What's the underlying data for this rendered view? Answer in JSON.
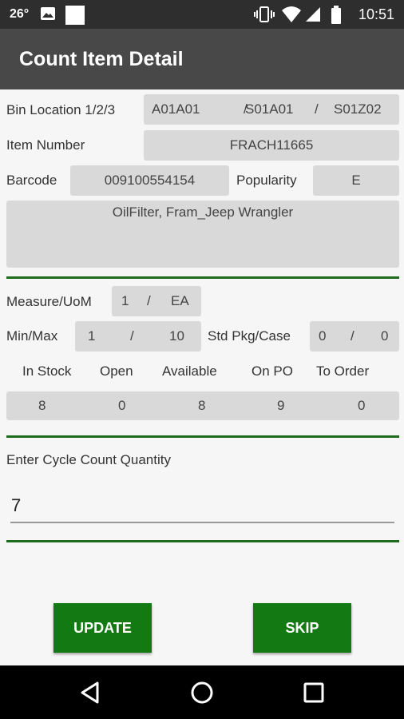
{
  "status_bar": {
    "temperature": "26°",
    "time": "10:51",
    "icons": [
      "image-icon",
      "square-notification-icon",
      "vibrate-icon",
      "wifi-icon",
      "signal-icon",
      "battery-icon"
    ]
  },
  "app_bar": {
    "title": "Count Item Detail"
  },
  "bin": {
    "label": "Bin Location 1/2/3",
    "loc1": "A01A01",
    "sep1": "/",
    "loc2": "S01A01",
    "sep2": "/",
    "loc3": "S01Z02"
  },
  "item": {
    "label": "Item Number",
    "value": "FRACH11665"
  },
  "barcode": {
    "label": "Barcode",
    "value": "009100554154"
  },
  "popularity": {
    "label": "Popularity",
    "value": "E"
  },
  "description": "OilFilter, Fram_Jeep Wrangler",
  "measure": {
    "label": "Measure/UoM",
    "qty": "1",
    "sep": "/",
    "uom": "EA"
  },
  "minmax": {
    "label": "Min/Max",
    "min": "1",
    "sep": "/",
    "max": "10"
  },
  "stdpkg": {
    "label": "Std Pkg/Case",
    "pkg": "0",
    "sep": "/",
    "case": "0"
  },
  "stock": {
    "headers": [
      "In Stock",
      "Open",
      "Available",
      "On PO",
      "To Order"
    ],
    "values": [
      "8",
      "0",
      "8",
      "9",
      "0"
    ]
  },
  "cycle_count": {
    "label": "Enter Cycle Count Quantity",
    "value": "7"
  },
  "buttons": {
    "update": "UPDATE",
    "skip": "SKIP"
  },
  "colors": {
    "accent": "#137a13",
    "separator": "#1e6b1e",
    "field": "#d9d9d9",
    "app_bar": "#484848",
    "status_bar": "#2e2e2e"
  }
}
